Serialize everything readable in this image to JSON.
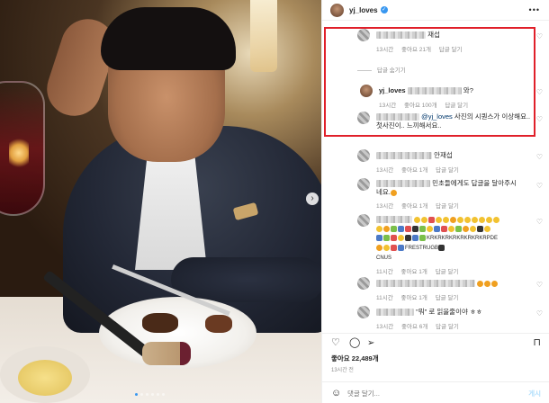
{
  "header": {
    "username": "yj_loves",
    "verified_icon": "verified-badge-icon",
    "menu_icon": "more-options-icon"
  },
  "comments": [
    {
      "author_suffix": "재섭",
      "text": "",
      "time": "13시간",
      "likes": "좋아요 21개",
      "reply": "답글 달기"
    },
    {
      "toggle": "답글 숨기기"
    },
    {
      "author": "yj_loves",
      "text_suffix": "와?",
      "time": "13시간",
      "likes": "좋아요 100개",
      "reply": "답글 달기"
    },
    {
      "mention": "@yj_loves",
      "text": "사진의 시퀀스가 이상해요..",
      "text2": "첫사진이.. 느끼해서요..",
      "time": "",
      "likes": "",
      "reply": ""
    },
    {
      "author_suffix": "안재섭",
      "time": "13시간",
      "likes": "좋아요 1개",
      "reply": "답글 달기"
    },
    {
      "text": "민초들에게도 답글을 달아주시",
      "text2": "네요.",
      "time": "13시간",
      "likes": "좋아요 1개",
      "reply": "답글 달기"
    },
    {
      "text": "KRKRKRKRKRKRKRKRPDE",
      "text_prefix": "FRESTRUGB",
      "text2": "CNUS",
      "time": "11시간",
      "likes": "좋아요 1개",
      "reply": "답글 달기"
    },
    {
      "time": "11시간",
      "likes": "좋아요 1개",
      "reply": "답글 달기"
    },
    {
      "text": "\"뭐\" 로 읽을줄이야 ㅎㅎ",
      "time": "13시간",
      "likes": "좋아요 6개",
      "reply": "답글 달기"
    }
  ],
  "actions": {
    "like_icon": "heart-icon",
    "comment_icon": "comment-icon",
    "share_icon": "share-icon",
    "save_icon": "bookmark-icon"
  },
  "likes_text": "좋아요 22,489개",
  "time_text": "13시간 전",
  "add_comment": {
    "placeholder": "댓글 달기...",
    "post_label": "게시"
  },
  "carousel": {
    "total": 6,
    "active": 0
  }
}
